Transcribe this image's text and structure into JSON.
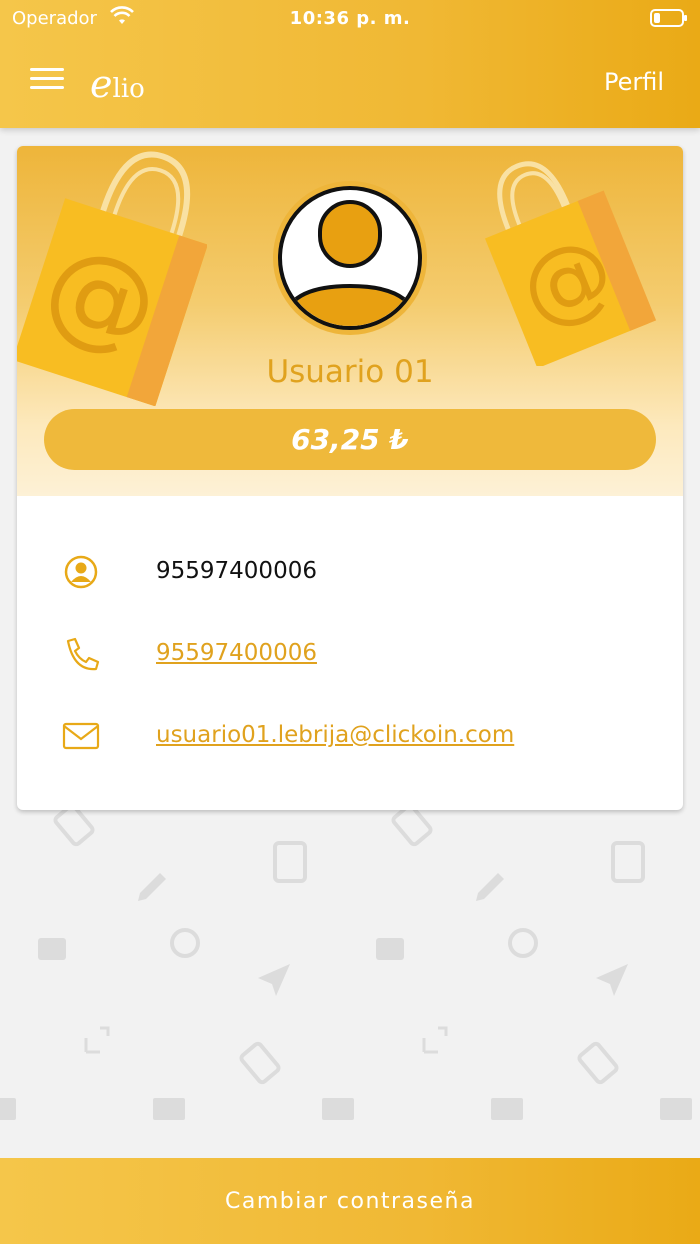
{
  "status_bar": {
    "carrier": "Operador",
    "time": "10:36 p. m."
  },
  "header": {
    "logo_e": "e",
    "logo_rest": "lio",
    "profile_label": "Perfil"
  },
  "profile": {
    "username": "Usuario 01",
    "balance": "63,25 ₺",
    "rows": [
      {
        "icon": "user-circle-icon",
        "value": "95597400006",
        "link": false
      },
      {
        "icon": "phone-icon",
        "value": "95597400006",
        "link": true
      },
      {
        "icon": "mail-icon",
        "value": "usuario01.lebrija@clickoin.com",
        "link": true
      }
    ]
  },
  "footer": {
    "change_password_label": "Cambiar contraseña"
  },
  "colors": {
    "accent": "#f0b834",
    "accent_dark": "#e0a21e",
    "background": "#f2f2f2"
  }
}
